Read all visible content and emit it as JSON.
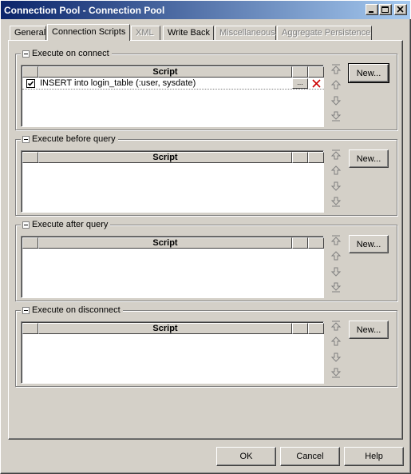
{
  "window": {
    "title": "Connection Pool - Connection Pool"
  },
  "tabs": [
    {
      "label": "General",
      "state": "normal"
    },
    {
      "label": "Connection Scripts",
      "state": "active"
    },
    {
      "label": "XML",
      "state": "disabled"
    },
    {
      "label": "Write Back",
      "state": "normal"
    },
    {
      "label": "Miscellaneous",
      "state": "disabled"
    },
    {
      "label": "Aggregate Persistence",
      "state": "disabled"
    }
  ],
  "groups": [
    {
      "legend": "Execute on connect",
      "column_header": "Script",
      "new_label": "New...",
      "rows": [
        {
          "checked": true,
          "text": "INSERT into login_table (:user, sysdate)",
          "ellipsis": "..."
        }
      ]
    },
    {
      "legend": "Execute before query",
      "column_header": "Script",
      "new_label": "New...",
      "rows": []
    },
    {
      "legend": "Execute after query",
      "column_header": "Script",
      "new_label": "New...",
      "rows": []
    },
    {
      "legend": "Execute on disconnect",
      "column_header": "Script",
      "new_label": "New...",
      "rows": []
    }
  ],
  "buttons": {
    "ok": "OK",
    "cancel": "Cancel",
    "help": "Help"
  },
  "icons": {
    "move_top": "move-top-icon",
    "move_up": "move-up-icon",
    "move_down": "move-down-icon",
    "move_bottom": "move-bottom-icon",
    "delete": "delete-icon"
  },
  "colors": {
    "titlebar_start": "#0a246a",
    "titlebar_end": "#a6caf0",
    "face": "#d4d0c8",
    "delete_red": "#cc0000"
  }
}
